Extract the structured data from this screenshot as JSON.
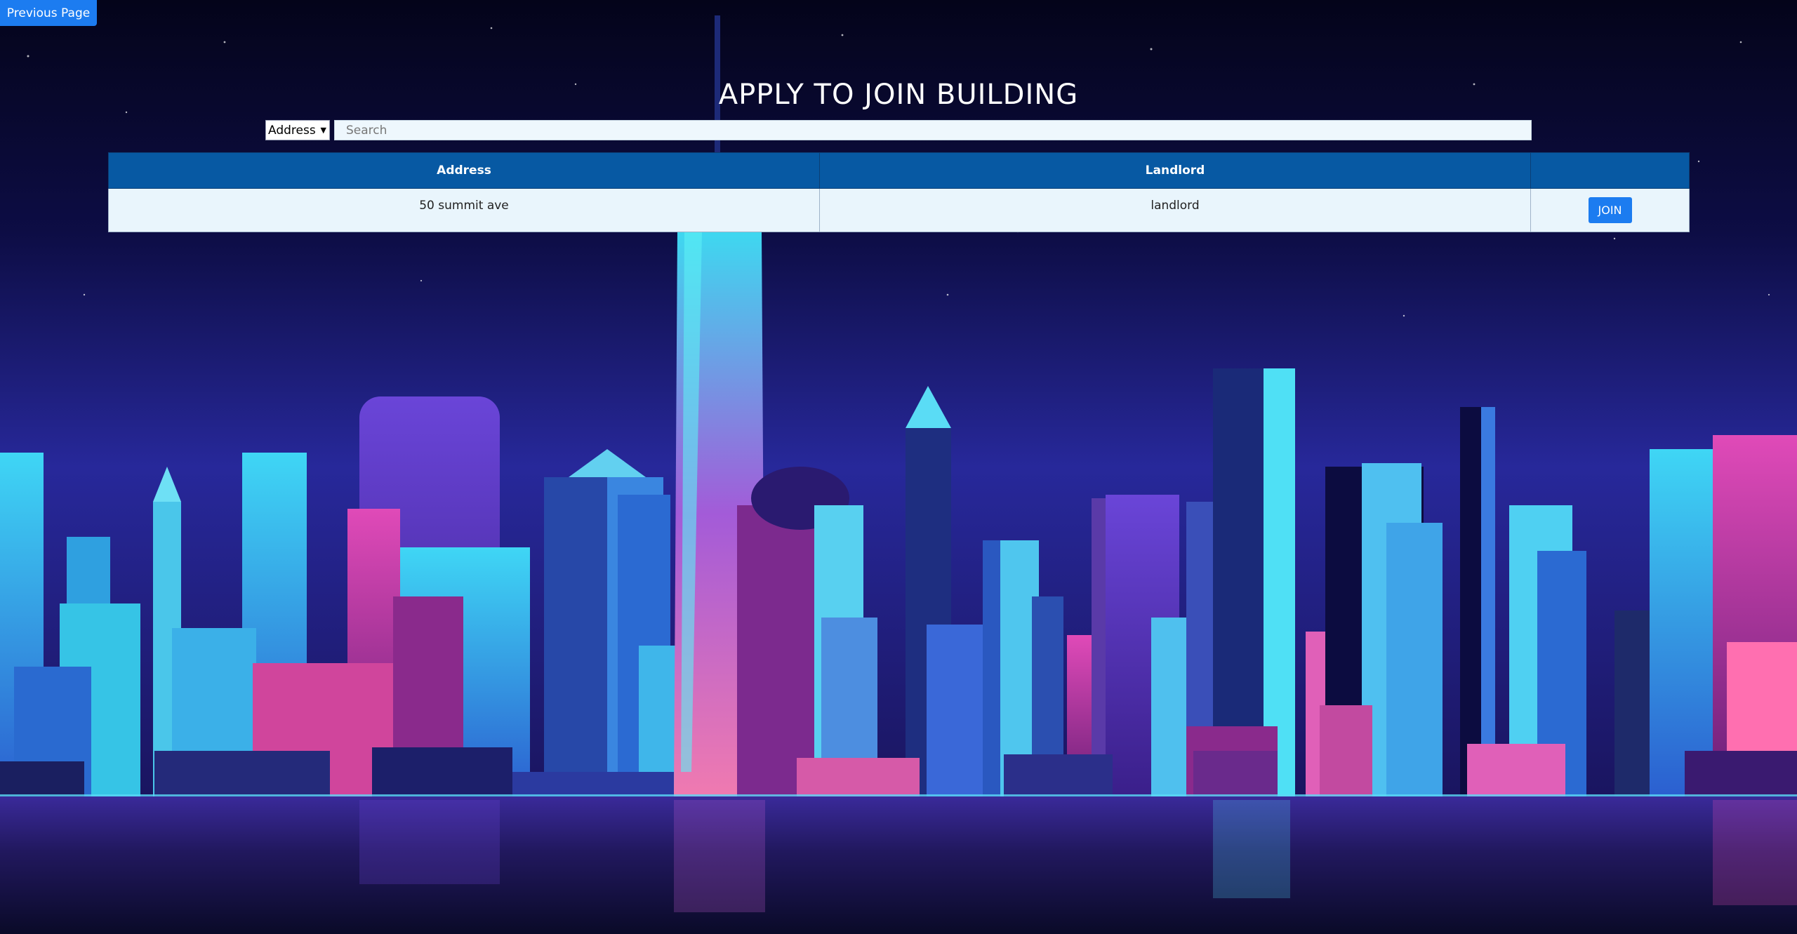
{
  "nav": {
    "previous_label": "Previous Page"
  },
  "page": {
    "title": "APPLY TO JOIN BUILDING"
  },
  "search": {
    "filter_selected": "Address",
    "filter_options": [
      "Address"
    ],
    "placeholder": "Search",
    "value": ""
  },
  "table": {
    "columns": [
      "Address",
      "Landlord",
      ""
    ],
    "rows": [
      {
        "address": "50 summit ave",
        "landlord": "landlord",
        "action_label": "JOIN"
      }
    ]
  },
  "colors": {
    "accent": "#1c7cf0",
    "table_header": "#0759a3",
    "table_cell": "#e9f5fc"
  },
  "icons": {
    "select_arrow": "chevron-down-icon"
  }
}
